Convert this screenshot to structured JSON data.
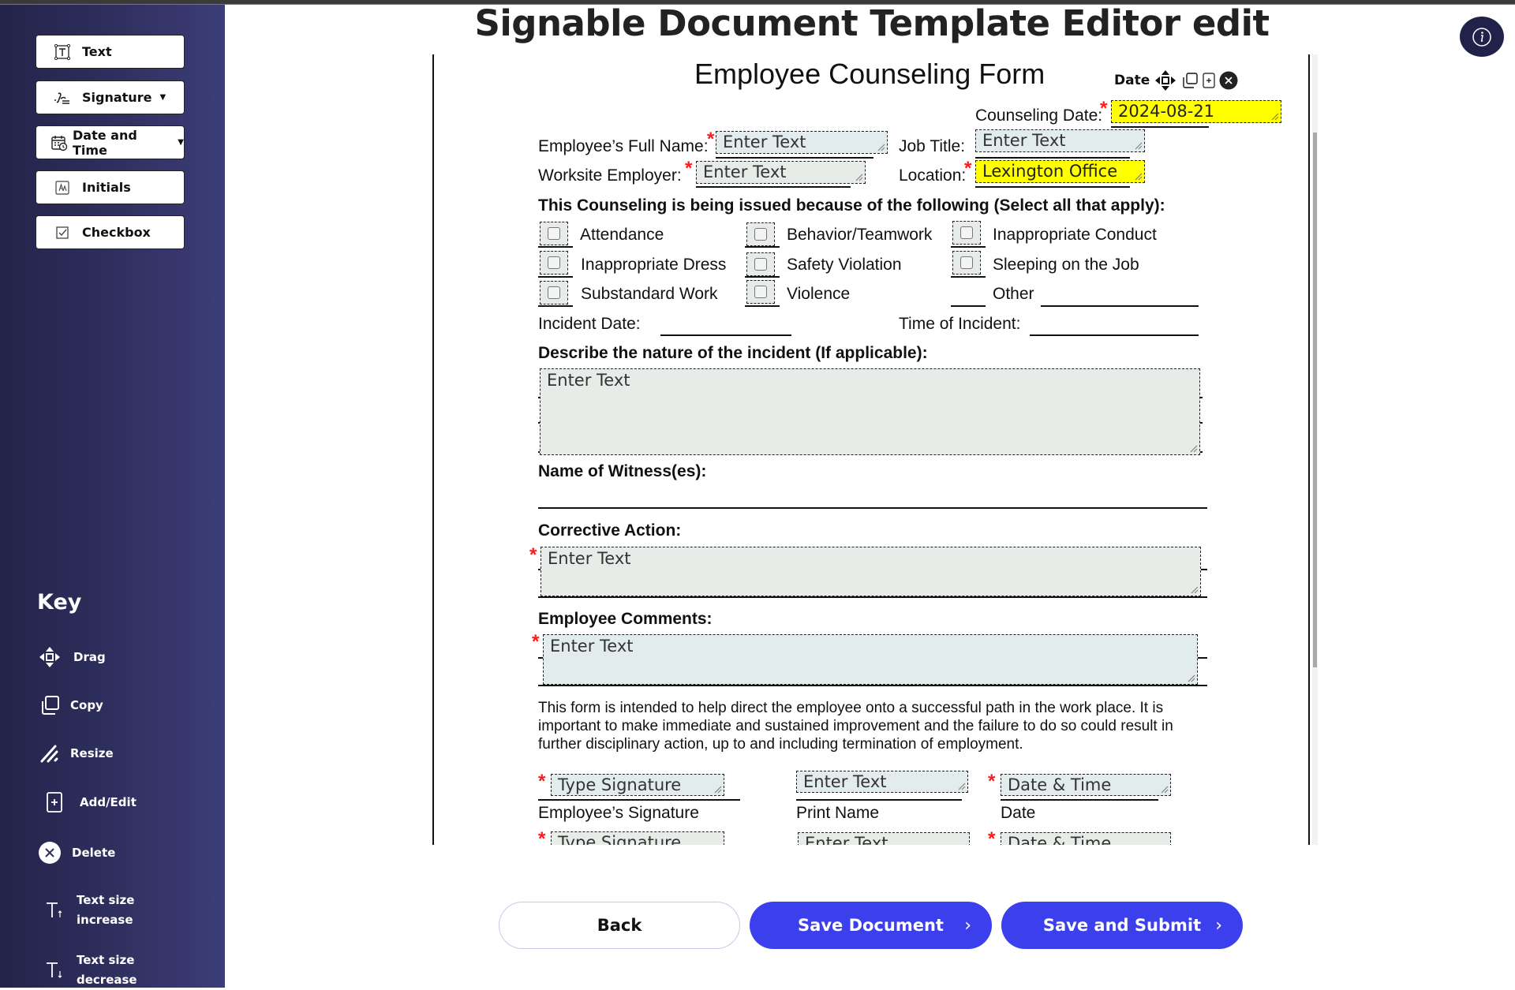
{
  "page": {
    "title": "Signable Document Template Editor edit"
  },
  "sidebar": {
    "tools": [
      {
        "label": "Text",
        "icon": "text-box-icon",
        "has_dropdown": false
      },
      {
        "label": "Signature",
        "icon": "signature-icon",
        "has_dropdown": true
      },
      {
        "label": "Date and Time",
        "icon": "calendar-clock-icon",
        "has_dropdown": true
      },
      {
        "label": "Initials",
        "icon": "initials-icon",
        "has_dropdown": false
      },
      {
        "label": "Checkbox",
        "icon": "checkbox-icon",
        "has_dropdown": false
      }
    ],
    "key": {
      "title": "Key",
      "items": [
        {
          "label": "Drag",
          "icon": "drag-move-icon"
        },
        {
          "label": "Copy",
          "icon": "copy-icon"
        },
        {
          "label": "Resize",
          "icon": "resize-icon"
        },
        {
          "label": "Add/Edit",
          "icon": "add-edit-icon"
        },
        {
          "label": "Delete",
          "icon": "delete-icon"
        },
        {
          "label": "Text size increase",
          "line1": "Text size",
          "line2": "increase",
          "icon": "text-size-increase-icon"
        },
        {
          "label": "Text size decrease",
          "line1": "Text size",
          "line2": "decrease",
          "icon": "text-size-decrease-icon"
        }
      ]
    }
  },
  "document": {
    "form_title": "Employee Counseling Form",
    "active_field_toolbar": {
      "label": "Date"
    },
    "counseling_date": {
      "label": "Counseling Date:",
      "value": "2024-08-21",
      "required": true
    },
    "employee_name": {
      "label": "Employee’s Full Name:",
      "placeholder": "Enter Text",
      "required": true
    },
    "job_title": {
      "label": "Job Title:",
      "placeholder": "Enter Text",
      "required": false
    },
    "worksite_employer": {
      "label": "Worksite Employer:",
      "placeholder": "Enter Text",
      "required": true
    },
    "location": {
      "label": "Location:",
      "value": "Lexington Office",
      "required": true
    },
    "reasons_heading": "This Counseling is being issued because of the following (Select all that apply):",
    "reasons": [
      {
        "label": "Attendance",
        "checked": false
      },
      {
        "label": "Behavior/Teamwork",
        "checked": false
      },
      {
        "label": "Inappropriate Conduct",
        "checked": false
      },
      {
        "label": "Inappropriate Dress",
        "checked": false
      },
      {
        "label": "Safety Violation",
        "checked": false
      },
      {
        "label": "Sleeping on the Job",
        "checked": false
      },
      {
        "label": "Substandard Work",
        "checked": false
      },
      {
        "label": "Violence",
        "checked": false
      }
    ],
    "other_label": "Other",
    "incident_date_label": "Incident Date:",
    "incident_time_label": "Time of Incident:",
    "describe_heading": "Describe the nature of the incident (If applicable):",
    "describe_placeholder": "Enter Text",
    "witness_heading": "Name of Witness(es):",
    "corrective_heading": "Corrective Action:",
    "corrective_placeholder": "Enter Text",
    "comments_heading": "Employee Comments:",
    "comments_placeholder": "Enter Text",
    "disclaimer": "This form is intended to help direct the employee onto a successful path in the work place. It is important to make immediate and sustained improvement and the failure to do so could result in further disciplinary action, up to and including termination of employment.",
    "signature_rows": [
      {
        "signature_placeholder": "Type Signature",
        "name_placeholder": "Enter Text",
        "date_placeholder": "Date & Time",
        "signature_label": "Employee’s Signature",
        "name_label": "Print Name",
        "date_label": "Date"
      },
      {
        "signature_placeholder": "Type Signature",
        "name_placeholder": "Enter Text",
        "date_placeholder": "Date & Time"
      }
    ]
  },
  "actions": {
    "back": "Back",
    "save_document": "Save Document",
    "save_and_submit": "Save and Submit"
  },
  "colors": {
    "primary": "#3c40ec",
    "sidebar_dark": "#23234a",
    "sidebar_light": "#3d3d78",
    "highlight_field": "#ffff00",
    "required_asterisk": "#ff1a1a"
  }
}
